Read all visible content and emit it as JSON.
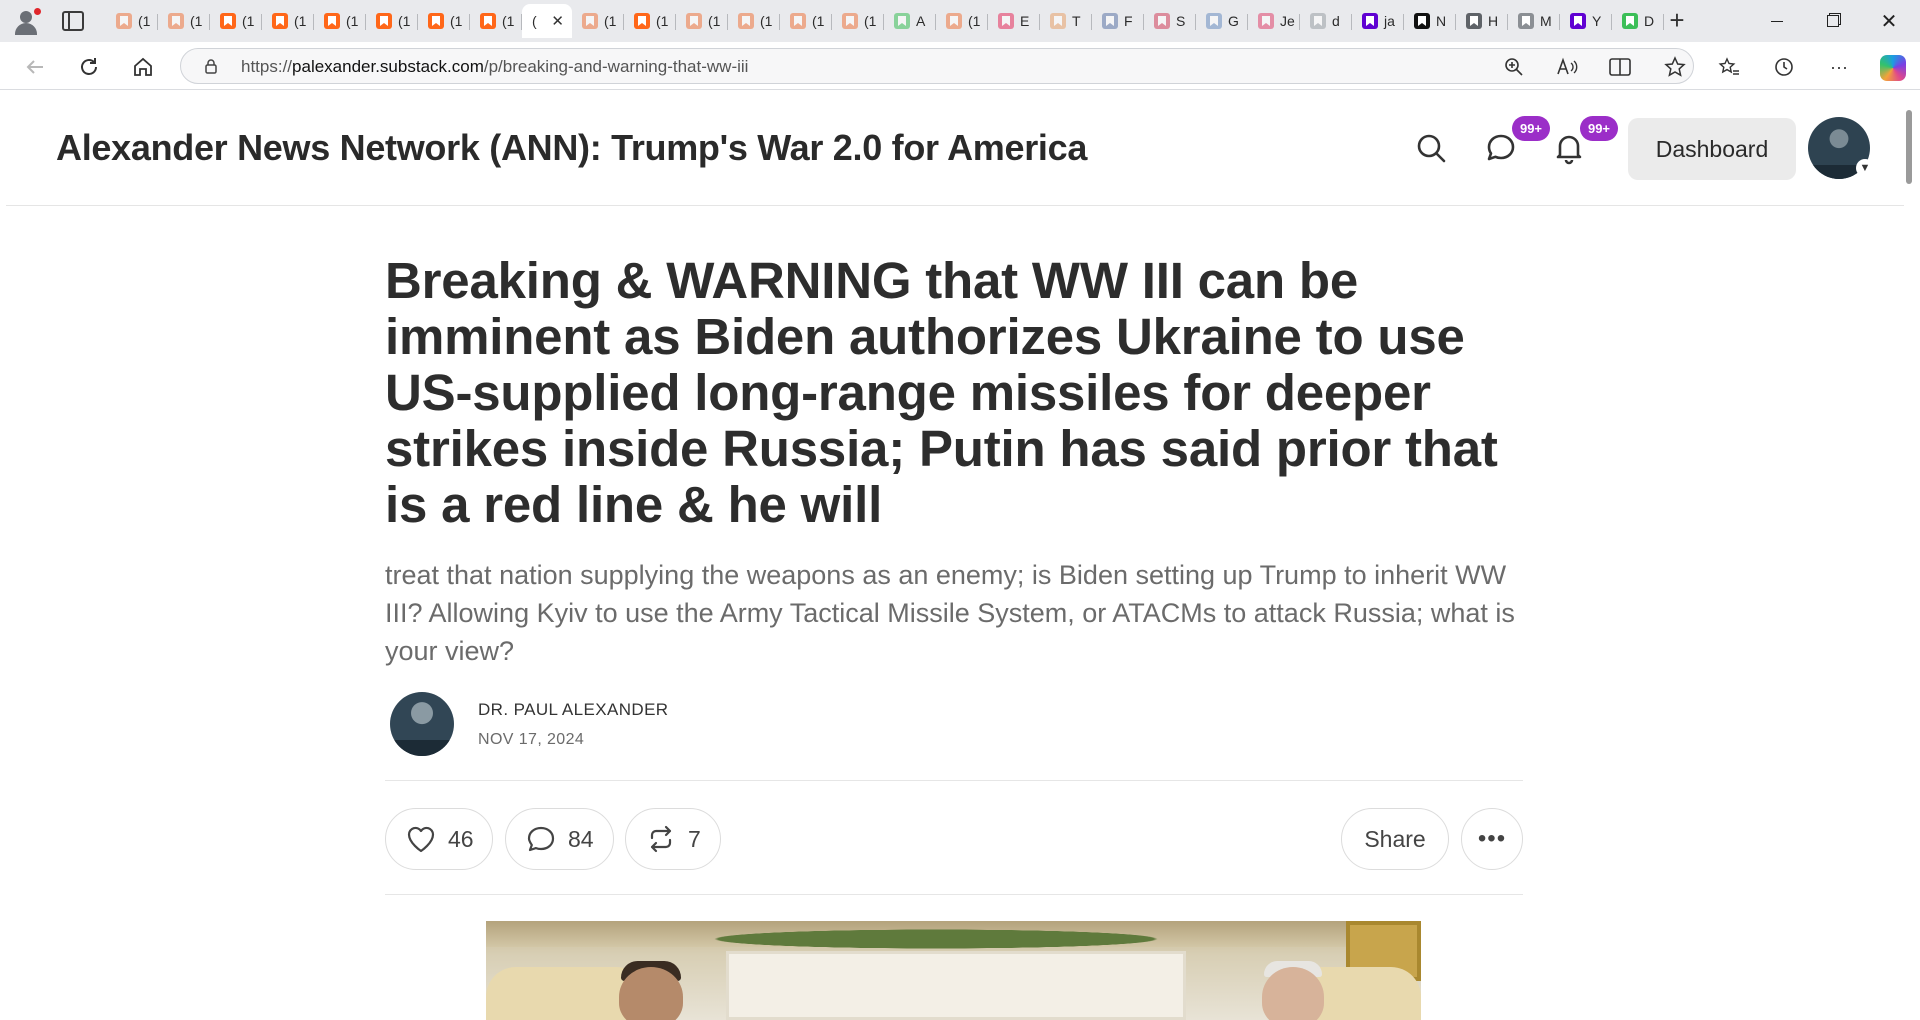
{
  "browser": {
    "tabs": [
      {
        "label": "(1",
        "color": "#f0773f",
        "dim": true
      },
      {
        "label": "(1",
        "color": "#f0773f",
        "dim": true
      },
      {
        "label": "(1",
        "color": "#ff6719",
        "dim": false
      },
      {
        "label": "(1",
        "color": "#ff6719",
        "dim": false
      },
      {
        "label": "(1",
        "color": "#ff6719",
        "dim": false
      },
      {
        "label": "(1",
        "color": "#ff6719",
        "dim": false
      },
      {
        "label": "(1",
        "color": "#ff6719",
        "dim": false
      },
      {
        "label": "(1",
        "color": "#ff6719",
        "dim": false
      },
      {
        "label": "(1",
        "color": "#f0773f",
        "dim": true
      },
      {
        "label": "(1",
        "color": "#ff6719",
        "dim": false
      },
      {
        "label": "(1",
        "color": "#f0773f",
        "dim": true
      },
      {
        "label": "(1",
        "color": "#f0773f",
        "dim": true
      },
      {
        "label": "(1",
        "color": "#f0773f",
        "dim": true
      },
      {
        "label": "(1",
        "color": "#f0773f",
        "dim": true
      },
      {
        "label": "A",
        "color": "#3cbf58",
        "dim": true
      },
      {
        "label": "(1",
        "color": "#f0773f",
        "dim": true
      },
      {
        "label": "E",
        "color": "#e62e5c",
        "dim": true
      },
      {
        "label": "T",
        "color": "#e8a36b",
        "dim": true
      },
      {
        "label": "F",
        "color": "#5f76a8",
        "dim": true
      },
      {
        "label": "S",
        "color": "#d2425c",
        "dim": true
      },
      {
        "label": "G",
        "color": "#6a8fc0",
        "dim": true
      },
      {
        "label": "Je",
        "color": "#e0436d",
        "dim": true
      },
      {
        "label": "d",
        "color": "#9aa0a6",
        "dim": true
      },
      {
        "label": "ja",
        "color": "#6001d2",
        "dim": false
      },
      {
        "label": "N",
        "color": "#111111",
        "dim": false
      },
      {
        "label": "H",
        "color": "#5f6368",
        "dim": false
      },
      {
        "label": "M",
        "color": "#8b8f94",
        "dim": false
      },
      {
        "label": "Y",
        "color": "#6001d2",
        "dim": false
      },
      {
        "label": "D",
        "color": "#3cbf58",
        "dim": false
      }
    ],
    "active_tab_label": "(",
    "url_prefix": "https://",
    "url_host": "palexander.substack.com",
    "url_path": "/p/breaking-and-warning-that-ww-iii"
  },
  "site": {
    "publication_title": "Alexander News Network (ANN): Trump's War 2.0 for America",
    "chat_badge": "99+",
    "bell_badge": "99+",
    "dashboard_label": "Dashboard"
  },
  "post": {
    "title": "Breaking & WARNING that WW III can be imminent as Biden authorizes Ukraine to use US-supplied long-range missiles for deeper strikes inside Russia; Putin has said prior that is a red line & he will",
    "subtitle": "treat that nation supplying the weapons as an enemy; is Biden setting up Trump to inherit WW III? Allowing Kyiv to use the Army Tactical Missile System, or ATACMs to attack Russia; what is your view?",
    "author": "DR. PAUL ALEXANDER",
    "date": "NOV 17, 2024",
    "likes": "46",
    "comments": "84",
    "restacks": "7",
    "share_label": "Share",
    "more_label": "•••"
  }
}
